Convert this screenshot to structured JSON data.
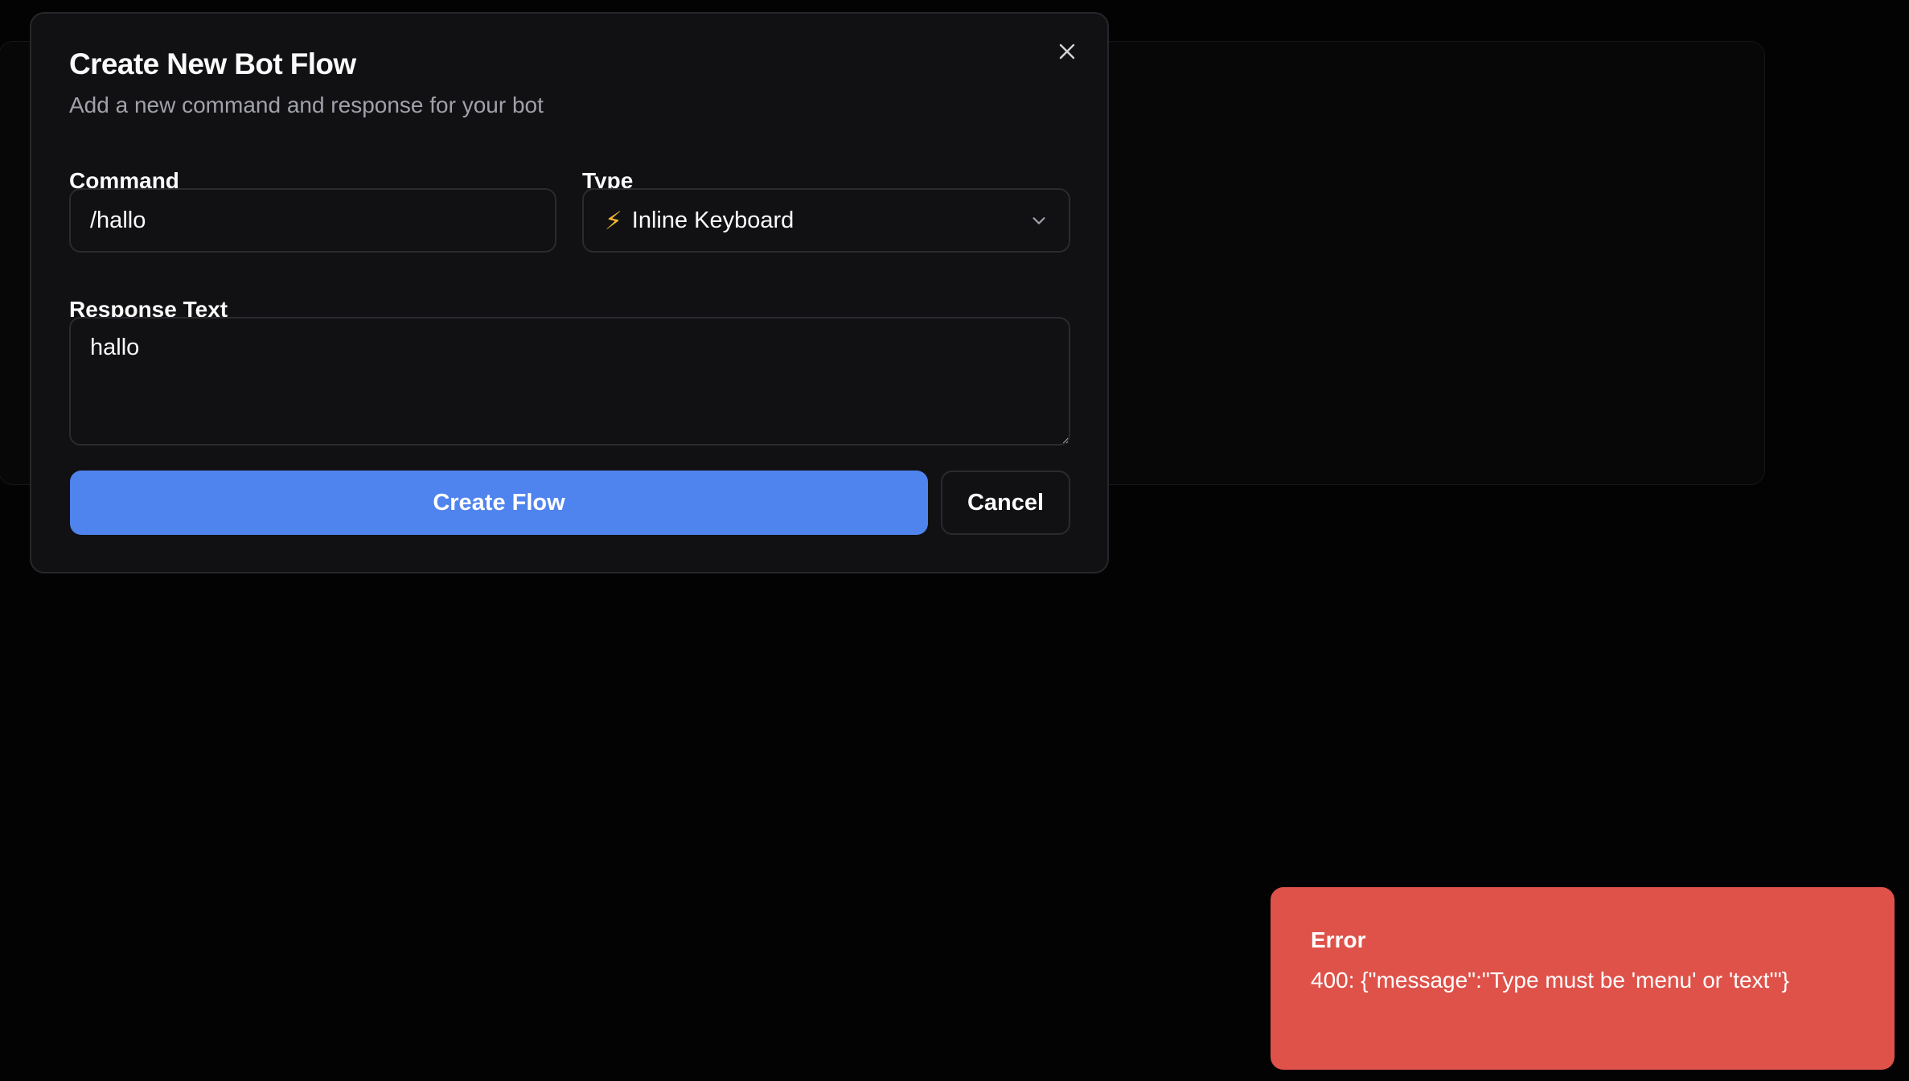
{
  "dialog": {
    "title": "Create New Bot Flow",
    "subtitle": "Add a new command and response for your bot",
    "close_icon": "close-icon",
    "command": {
      "label": "Command",
      "value": "/hallo"
    },
    "type": {
      "label": "Type",
      "icon": "lightning-bolt-icon",
      "icon_glyph": "⚡",
      "selected": "Inline Keyboard",
      "chevron_icon": "chevron-down-icon"
    },
    "response": {
      "label": "Response Text",
      "value": "hallo"
    },
    "actions": {
      "create_label": "Create Flow",
      "cancel_label": "Cancel"
    }
  },
  "toast": {
    "title": "Error",
    "message": "400: {\"message\":\"Type must be 'menu' or 'text'\"}"
  },
  "colors": {
    "background": "#030303",
    "dialog_background": "#111114",
    "primary": "#4f83ee",
    "error": "#de524a",
    "muted_text": "#a1a1aa",
    "bolt": "#f5b82e"
  }
}
